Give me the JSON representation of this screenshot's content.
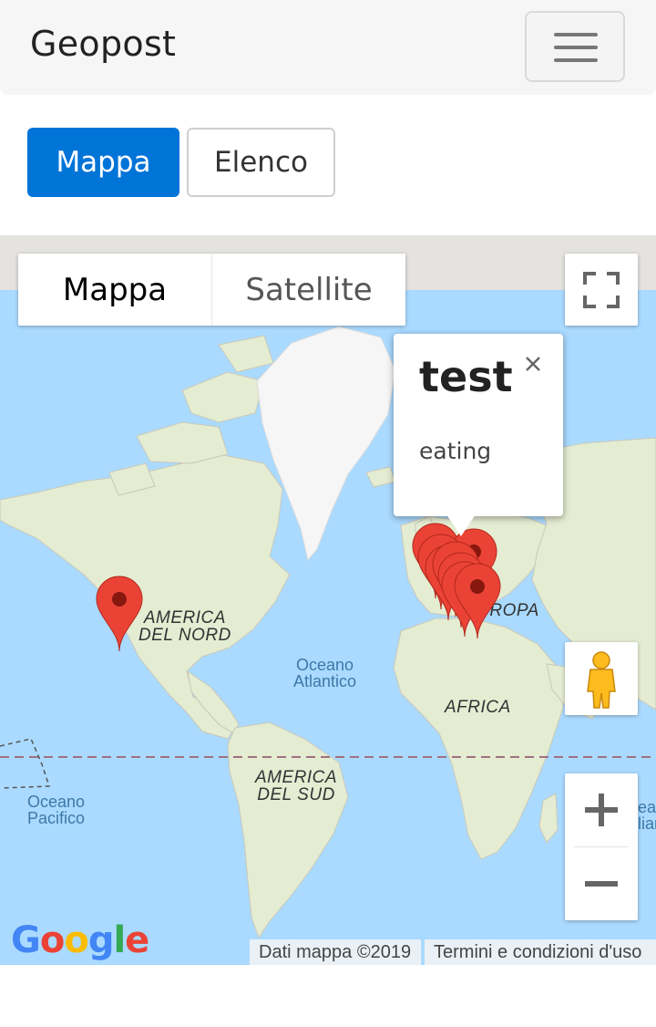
{
  "navbar": {
    "brand": "Geopost",
    "toggle_icon": "hamburger-icon"
  },
  "view_switch": {
    "map_label": "Mappa",
    "list_label": "Elenco",
    "active": "Mappa"
  },
  "map": {
    "map_type": {
      "map_label": "Mappa",
      "satellite_label": "Satellite",
      "selected": "Mappa"
    },
    "fullscreen_icon": "fullscreen-icon",
    "pegman_icon": "street-view-pegman-icon",
    "zoom_in_icon": "plus-icon",
    "zoom_out_icon": "minus-icon",
    "infowindow": {
      "title": "test",
      "body": "eating",
      "close_icon": "close-icon"
    },
    "labels": {
      "north_america": [
        "AMERICA",
        "DEL NORD"
      ],
      "south_america": [
        "AMERICA",
        "DEL SUD"
      ],
      "africa": "AFRICA",
      "europe": "EUROPA",
      "atlantic": [
        "Oceano",
        "Atlantico"
      ],
      "pacific": [
        "Oceano",
        "Pacifico"
      ],
      "indian_partial": [
        "ear",
        "lian"
      ]
    },
    "logo": "Google",
    "attribution": "Dati mappa ©2019",
    "terms": "Termini e condizioni d'uso",
    "marker_color": "#ea4335",
    "water_color": "#aadaff",
    "land_color": "#e8efd8"
  }
}
